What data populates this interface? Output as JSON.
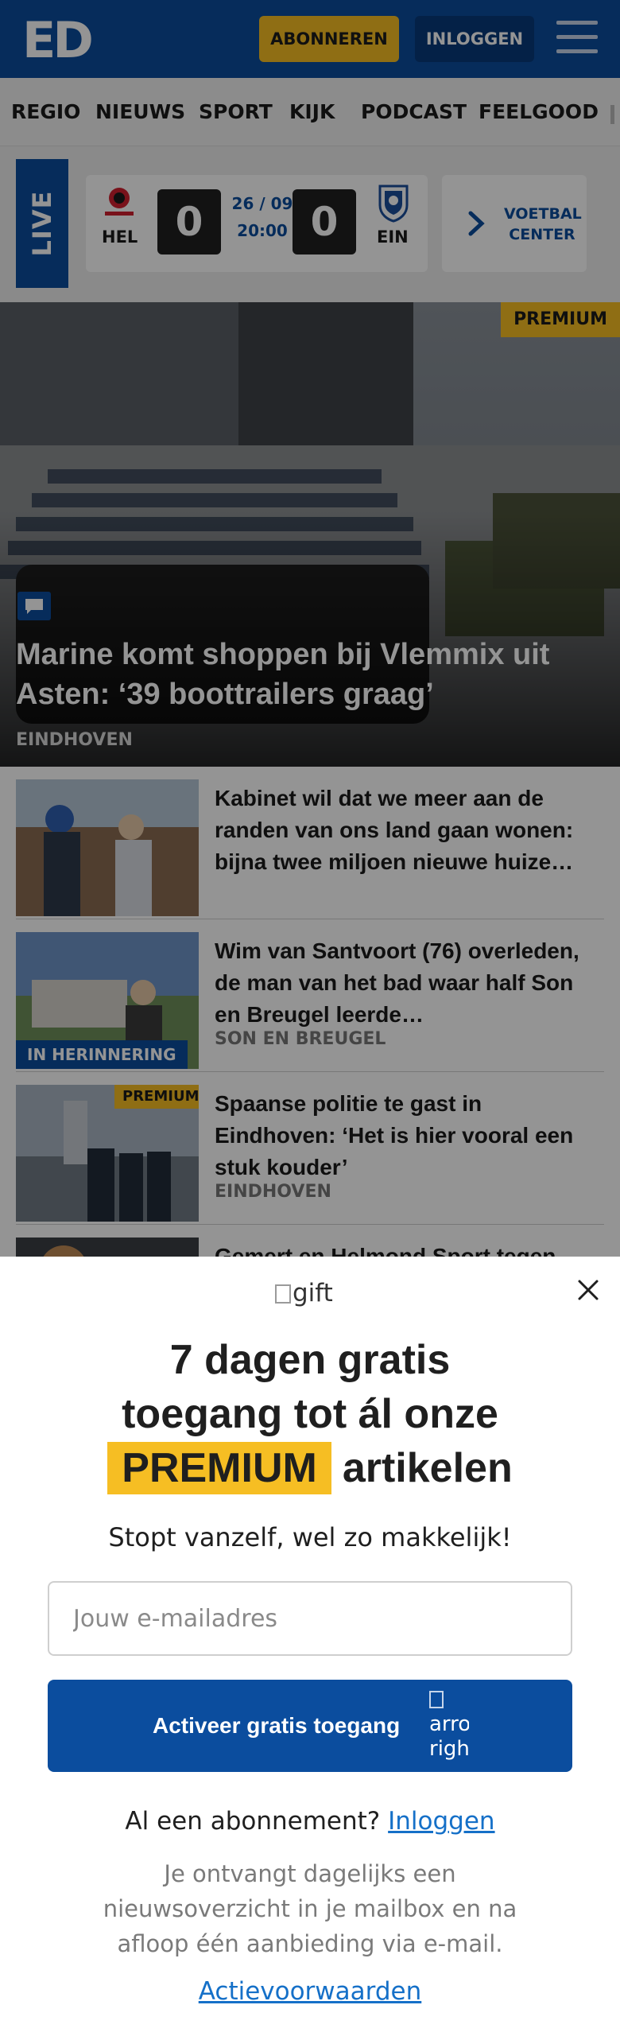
{
  "header": {
    "logo": "ED",
    "subscribe_label": "ABONNEREN",
    "login_label": "INLOGGEN"
  },
  "nav": {
    "items": [
      "REGIO",
      "NIEUWS",
      "SPORT",
      "KIJK",
      "PODCAST",
      "FEELGOOD"
    ]
  },
  "live": {
    "tag": "LIVE",
    "home_team": "HEL",
    "away_team": "EIN",
    "home_score": "0",
    "away_score": "0",
    "date": "26 / 09",
    "time": "20:00",
    "voetbal_label": "VOETBAL CENTER"
  },
  "hero": {
    "badge": "PREMIUM",
    "title": "Marine komt shoppen bij Vlemmix uit Asten: ‘39 boottrailers graag’",
    "location": "EINDHOVEN"
  },
  "articles": [
    {
      "title": "Kabinet wil dat we meer aan de randen van ons land gaan wonen: bijna twee miljoen nieuwe huize…",
      "location": ""
    },
    {
      "title": "Wim van Santvoort (76) overleden, de man van het bad waar half Son en Breugel leerde…",
      "location": "SON EN BREUGEL",
      "tag": "IN HERINNERING"
    },
    {
      "title": "Spaanse politie te gast in Eindhoven: ‘Het is hier vooral een stuk kouder’",
      "location": "EINDHOVEN",
      "badge": "PREMIUM"
    },
    {
      "title": "Gemert en Helmond Sport tegen…",
      "location": ""
    }
  ],
  "modal": {
    "gift_alt": "gift",
    "title_line1": "7 dagen gratis",
    "title_line2": "toegang tot ál onze",
    "title_premium": "PREMIUM",
    "title_line3_rest": "artikelen",
    "subtitle": "Stopt vanzelf, wel zo makkelijk!",
    "email_placeholder": "Jouw e-mailadres",
    "activate_label": "Activeer gratis toegang",
    "arrow_alt": "arrow right",
    "login_prompt": "Al een abonnement?",
    "login_link": "Inloggen",
    "info": "Je ontvangt dagelijks een nieuwsoverzicht in je mailbox en na afloop één aanbieding via e-mail.",
    "terms_link": "Actievoorwaarden"
  },
  "colors": {
    "brand_blue": "#0b4d9e",
    "accent_yellow": "#f6be23",
    "link_blue": "#1570c8"
  }
}
